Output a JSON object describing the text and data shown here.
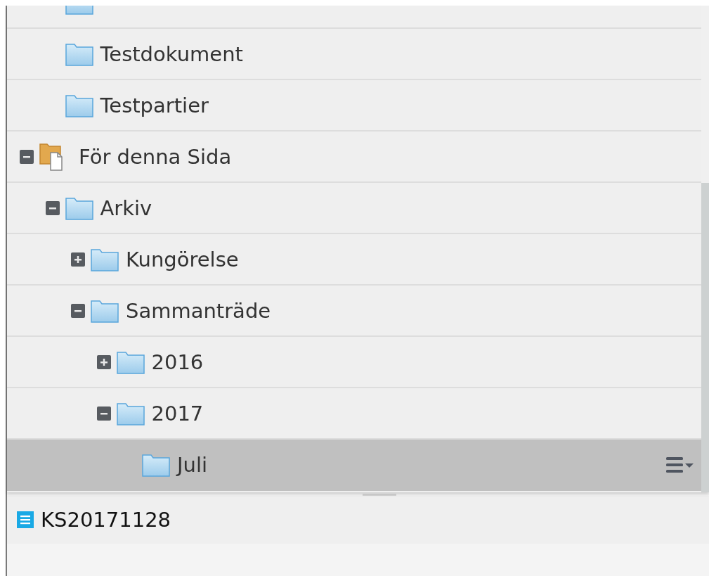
{
  "tree": [
    {
      "children": [
        {
          "kind": "folder",
          "selected": false
        },
        {
          "label": "Testdokument",
          "kind": "folder",
          "selected": false
        },
        {
          "label": "Testpartier",
          "kind": "folder",
          "selected": false
        }
      ]
    },
    {
      "label": "För denna Sida",
      "kind": "page-folder",
      "expanded": true,
      "selected": false,
      "children": [
        {
          "label": "Arkiv",
          "kind": "folder",
          "expanded": true,
          "selected": false,
          "children": [
            {
              "label": "Kungörelse",
              "kind": "folder",
              "expanded": false,
              "selected": false
            },
            {
              "label": "Sammanträde",
              "kind": "folder",
              "expanded": true,
              "selected": false,
              "children": [
                {
                  "label": "2016",
                  "kind": "folder",
                  "expanded": false,
                  "selected": false
                },
                {
                  "label": "2017",
                  "kind": "folder",
                  "expanded": true,
                  "selected": false,
                  "children": [
                    {
                      "label": "Juli",
                      "kind": "folder",
                      "selected": true,
                      "menu": true
                    }
                  ]
                }
              ]
            }
          ]
        }
      ]
    }
  ],
  "document": {
    "label": "KS20171128"
  }
}
